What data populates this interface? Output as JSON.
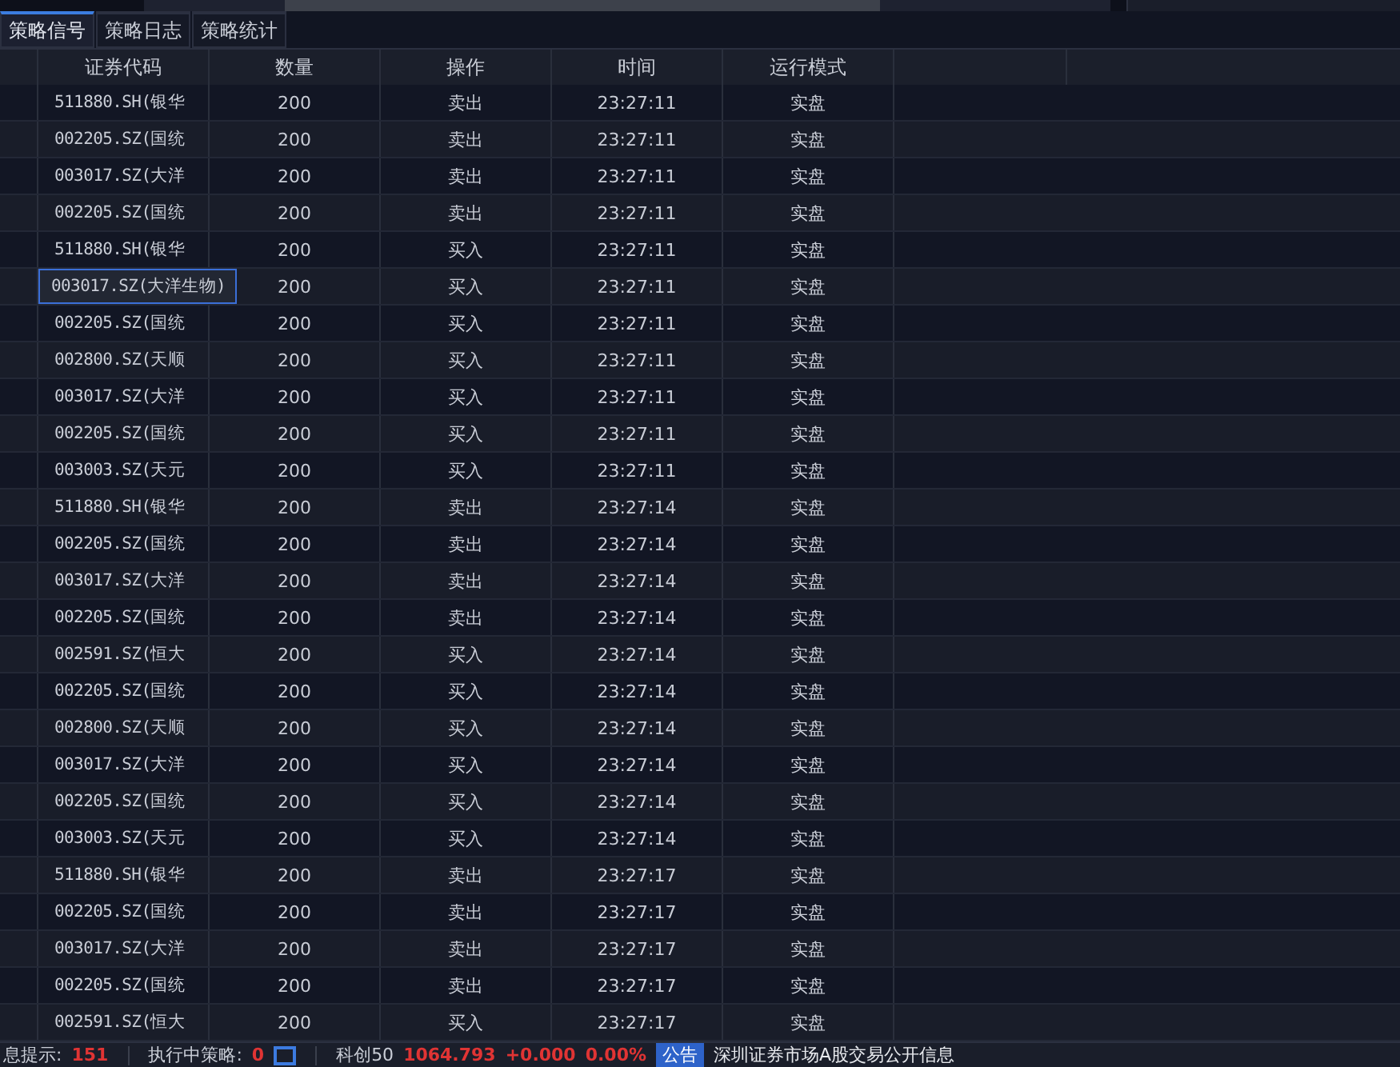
{
  "tabs": [
    {
      "label": "策略信号",
      "selected": true
    },
    {
      "label": "策略日志",
      "selected": false
    },
    {
      "label": "策略统计",
      "selected": false
    }
  ],
  "table": {
    "columns": [
      "证券代码",
      "数量",
      "操作",
      "时间",
      "运行模式"
    ],
    "rows": [
      {
        "code": "511880.SH(银华",
        "quantity": "200",
        "action": "卖出",
        "time": "23:27:11",
        "mode": "实盘",
        "selected": false
      },
      {
        "code": "002205.SZ(国统",
        "quantity": "200",
        "action": "卖出",
        "time": "23:27:11",
        "mode": "实盘",
        "selected": false
      },
      {
        "code": "003017.SZ(大洋",
        "quantity": "200",
        "action": "卖出",
        "time": "23:27:11",
        "mode": "实盘",
        "selected": false
      },
      {
        "code": "002205.SZ(国统",
        "quantity": "200",
        "action": "卖出",
        "time": "23:27:11",
        "mode": "实盘",
        "selected": false
      },
      {
        "code": "511880.SH(银华",
        "quantity": "200",
        "action": "买入",
        "time": "23:27:11",
        "mode": "实盘",
        "selected": false
      },
      {
        "code": "003017.SZ(大洋生物)",
        "quantity": "200",
        "action": "买入",
        "time": "23:27:11",
        "mode": "实盘",
        "selected": true
      },
      {
        "code": "002205.SZ(国统",
        "quantity": "200",
        "action": "买入",
        "time": "23:27:11",
        "mode": "实盘",
        "selected": false
      },
      {
        "code": "002800.SZ(天顺",
        "quantity": "200",
        "action": "买入",
        "time": "23:27:11",
        "mode": "实盘",
        "selected": false
      },
      {
        "code": "003017.SZ(大洋",
        "quantity": "200",
        "action": "买入",
        "time": "23:27:11",
        "mode": "实盘",
        "selected": false
      },
      {
        "code": "002205.SZ(国统",
        "quantity": "200",
        "action": "买入",
        "time": "23:27:11",
        "mode": "实盘",
        "selected": false
      },
      {
        "code": "003003.SZ(天元",
        "quantity": "200",
        "action": "买入",
        "time": "23:27:11",
        "mode": "实盘",
        "selected": false
      },
      {
        "code": "511880.SH(银华",
        "quantity": "200",
        "action": "卖出",
        "time": "23:27:14",
        "mode": "实盘",
        "selected": false
      },
      {
        "code": "002205.SZ(国统",
        "quantity": "200",
        "action": "卖出",
        "time": "23:27:14",
        "mode": "实盘",
        "selected": false
      },
      {
        "code": "003017.SZ(大洋",
        "quantity": "200",
        "action": "卖出",
        "time": "23:27:14",
        "mode": "实盘",
        "selected": false
      },
      {
        "code": "002205.SZ(国统",
        "quantity": "200",
        "action": "卖出",
        "time": "23:27:14",
        "mode": "实盘",
        "selected": false
      },
      {
        "code": "002591.SZ(恒大",
        "quantity": "200",
        "action": "买入",
        "time": "23:27:14",
        "mode": "实盘",
        "selected": false
      },
      {
        "code": "002205.SZ(国统",
        "quantity": "200",
        "action": "买入",
        "time": "23:27:14",
        "mode": "实盘",
        "selected": false
      },
      {
        "code": "002800.SZ(天顺",
        "quantity": "200",
        "action": "买入",
        "time": "23:27:14",
        "mode": "实盘",
        "selected": false
      },
      {
        "code": "003017.SZ(大洋",
        "quantity": "200",
        "action": "买入",
        "time": "23:27:14",
        "mode": "实盘",
        "selected": false
      },
      {
        "code": "002205.SZ(国统",
        "quantity": "200",
        "action": "买入",
        "time": "23:27:14",
        "mode": "实盘",
        "selected": false
      },
      {
        "code": "003003.SZ(天元",
        "quantity": "200",
        "action": "买入",
        "time": "23:27:14",
        "mode": "实盘",
        "selected": false
      },
      {
        "code": "511880.SH(银华",
        "quantity": "200",
        "action": "卖出",
        "time": "23:27:17",
        "mode": "实盘",
        "selected": false
      },
      {
        "code": "002205.SZ(国统",
        "quantity": "200",
        "action": "卖出",
        "time": "23:27:17",
        "mode": "实盘",
        "selected": false
      },
      {
        "code": "003017.SZ(大洋",
        "quantity": "200",
        "action": "卖出",
        "time": "23:27:17",
        "mode": "实盘",
        "selected": false
      },
      {
        "code": "002205.SZ(国统",
        "quantity": "200",
        "action": "卖出",
        "time": "23:27:17",
        "mode": "实盘",
        "selected": false
      },
      {
        "code": "002591.SZ(恒大",
        "quantity": "200",
        "action": "买入",
        "time": "23:27:17",
        "mode": "实盘",
        "selected": false
      }
    ]
  },
  "status_bar": {
    "message_label": "息提示:",
    "message_count": "151",
    "running_label": "执行中策略:",
    "running_count": "0",
    "index_name": "科创50",
    "index_value": "1064.793",
    "index_change": "+0.000",
    "index_percent": "0.00%",
    "notice_badge": "公告",
    "notice_text": "深圳证券市场A股交易公开信息"
  }
}
